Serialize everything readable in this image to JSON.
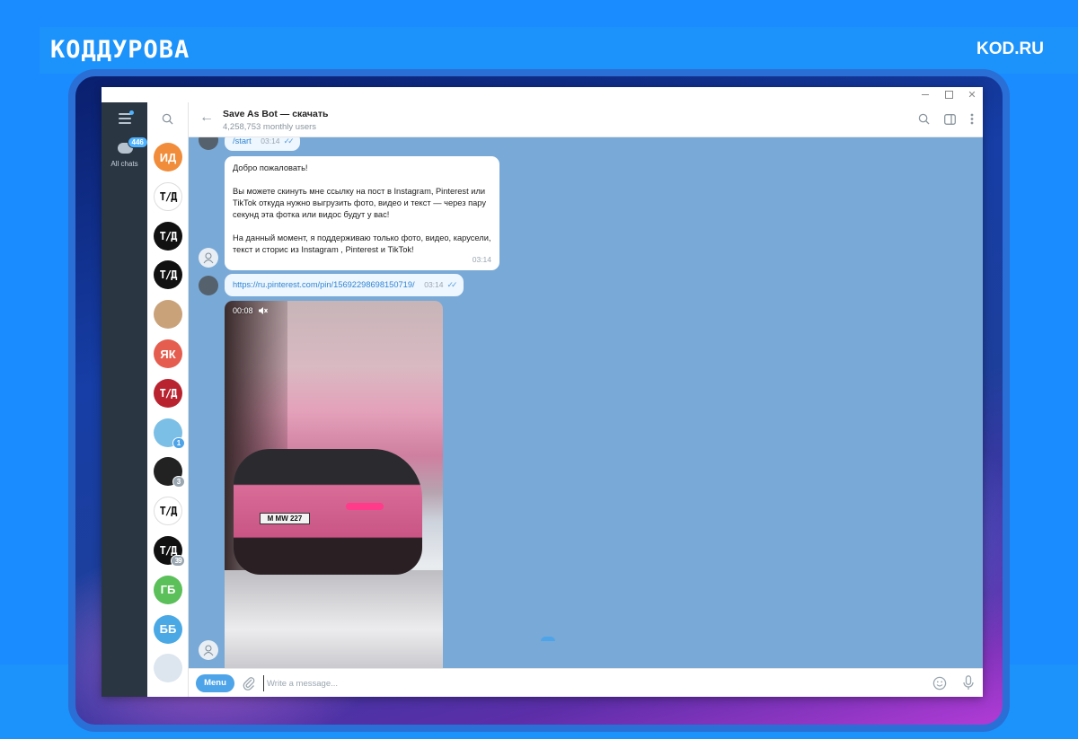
{
  "brand": {
    "logo": "КОДДУРОВА",
    "site": "KOD.RU"
  },
  "window": {
    "controls": [
      "minimize",
      "maximize",
      "close"
    ]
  },
  "rail": {
    "all_chats_label": "All chats",
    "all_chats_badge": "446"
  },
  "chat_list": {
    "avatars": [
      {
        "initials": "ИД",
        "color": "#f08c3a",
        "badge": ""
      },
      {
        "initials": "T/Д",
        "color": "#ffffff",
        "text_color": "#111111",
        "badge": ""
      },
      {
        "initials": "T/Д",
        "color": "#111111",
        "badge": ""
      },
      {
        "initials": "T/Д",
        "color": "#111111",
        "badge": ""
      },
      {
        "initials": "",
        "color": "#c9a27a",
        "badge": ""
      },
      {
        "initials": "ЯК",
        "color": "#e55d4f",
        "badge": ""
      },
      {
        "initials": "T/Д",
        "color": "#b8232f",
        "badge": ""
      },
      {
        "initials": "",
        "color": "#7cbfe6",
        "badge": "1",
        "badge_color": "#4ea4e8"
      },
      {
        "initials": "",
        "color": "#222222",
        "badge": "3",
        "badge_color": "#9aa6b0"
      },
      {
        "initials": "T/Д",
        "color": "#ffffff",
        "text_color": "#111111",
        "badge": ""
      },
      {
        "initials": "T/Д",
        "color": "#111111",
        "badge": "39",
        "badge_color": "#9aa6b0"
      },
      {
        "initials": "ГБ",
        "color": "#5bbf5a",
        "badge": ""
      },
      {
        "initials": "ББ",
        "color": "#4aa9e5",
        "badge": ""
      },
      {
        "initials": "",
        "color": "#dde6ef",
        "badge": ""
      }
    ]
  },
  "header": {
    "title": "Save As Bot — скачать",
    "subtitle": "4,258,753 monthly users"
  },
  "messages": {
    "start_text": "/start",
    "start_time": "03:14",
    "welcome_paragraphs": [
      "Добро пожаловать!",
      "Вы можете скинуть мне ссылку на пост в Instagram, Pinterest или TikTok откуда нужно выгрузить фото, видео и текст — через пару секунд эта фотка или видос будут у вас!",
      "На данный момент, я поддерживаю только фото, видео, карусели, текст и сторис из Instagram , Pinterest и TikTok!"
    ],
    "welcome_time": "03:14",
    "link_text": "https://ru.pinterest.com/pin/15692298698150719/",
    "link_time": "03:14",
    "video_duration": "00:08",
    "video_plate": "M MW 227"
  },
  "composer": {
    "menu_label": "Menu",
    "placeholder": "Write a message..."
  },
  "colors": {
    "accent": "#4ea4e8",
    "chat_bg": "#79a9d6",
    "rail_bg": "#2b3643"
  }
}
